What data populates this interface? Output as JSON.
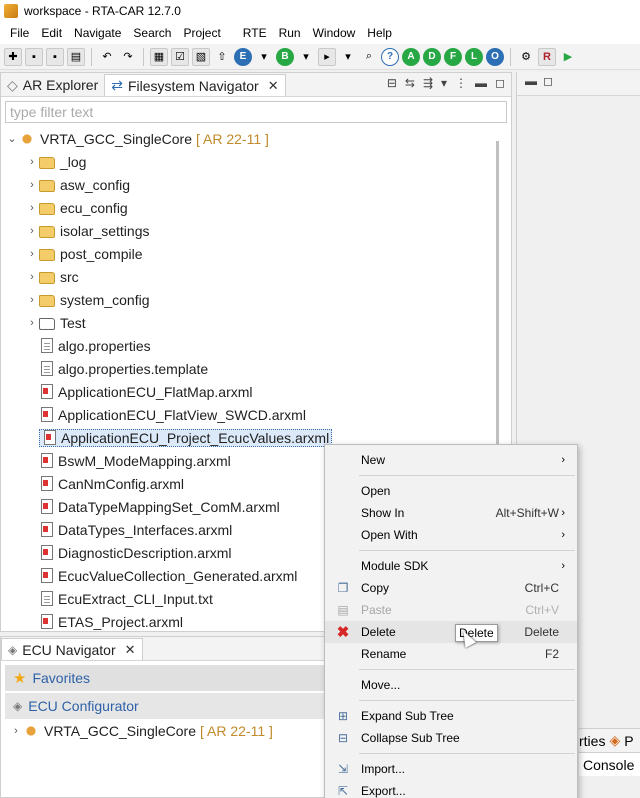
{
  "window": {
    "title": "workspace - RTA-CAR 12.7.0"
  },
  "menubar": [
    "File",
    "Edit",
    "Navigate",
    "Search",
    "Project",
    "RTE",
    "Run",
    "Window",
    "Help"
  ],
  "toolbar": {
    "circle_buttons": [
      "E",
      "B",
      "A",
      "D",
      "F",
      "L",
      "O"
    ],
    "r_label": "R"
  },
  "explorer": {
    "tabs": [
      {
        "label": "AR Explorer",
        "active": false
      },
      {
        "label": "Filesystem Navigator",
        "active": true
      }
    ],
    "filter_placeholder": "type filter text",
    "root": {
      "name": "VRTA_GCC_SingleCore",
      "tag": "[ AR 22-11 ]"
    },
    "folders": [
      "_log",
      "asw_config",
      "ecu_config",
      "isolar_settings",
      "post_compile",
      "src",
      "system_config",
      "Test"
    ],
    "files": [
      "algo.properties",
      "algo.properties.template",
      "ApplicationECU_FlatMap.arxml",
      "ApplicationECU_FlatView_SWCD.arxml",
      "ApplicationECU_Project_EcucValues.arxml",
      "BswM_ModeMapping.arxml",
      "CanNmConfig.arxml",
      "DataTypeMappingSet_ComM.arxml",
      "DataTypes_Interfaces.arxml",
      "DiagnosticDescription.arxml",
      "EcucValueCollection_Generated.arxml",
      "EcuExtract_CLI_Input.txt",
      "ETAS_Project.arxml"
    ],
    "selected_file": "ApplicationECU_Project_EcucValues.arxml"
  },
  "ecu_navigator": {
    "tab_label": "ECU Navigator",
    "sections": [
      "Favorites",
      "ECU Configurator"
    ],
    "root": {
      "name": "VRTA_GCC_SingleCore",
      "tag": "[ AR 22-11 ]"
    }
  },
  "right_pane": {
    "tab_partial_1": "rties",
    "tab_partial_2": "P",
    "console": "Console"
  },
  "context_menu": {
    "new": "New",
    "open": "Open",
    "show_in": "Show In",
    "show_in_shortcut": "Alt+Shift+W",
    "open_with": "Open With",
    "module_sdk": "Module SDK",
    "copy": "Copy",
    "copy_shortcut": "Ctrl+C",
    "paste": "Paste",
    "paste_shortcut": "Ctrl+V",
    "delete": "Delete",
    "delete_shortcut": "Delete",
    "rename": "Rename",
    "rename_shortcut": "F2",
    "move": "Move...",
    "expand": "Expand Sub Tree",
    "collapse": "Collapse Sub Tree",
    "import": "Import...",
    "export": "Export..."
  },
  "tooltip": "Delete",
  "close_glyph": "✕"
}
